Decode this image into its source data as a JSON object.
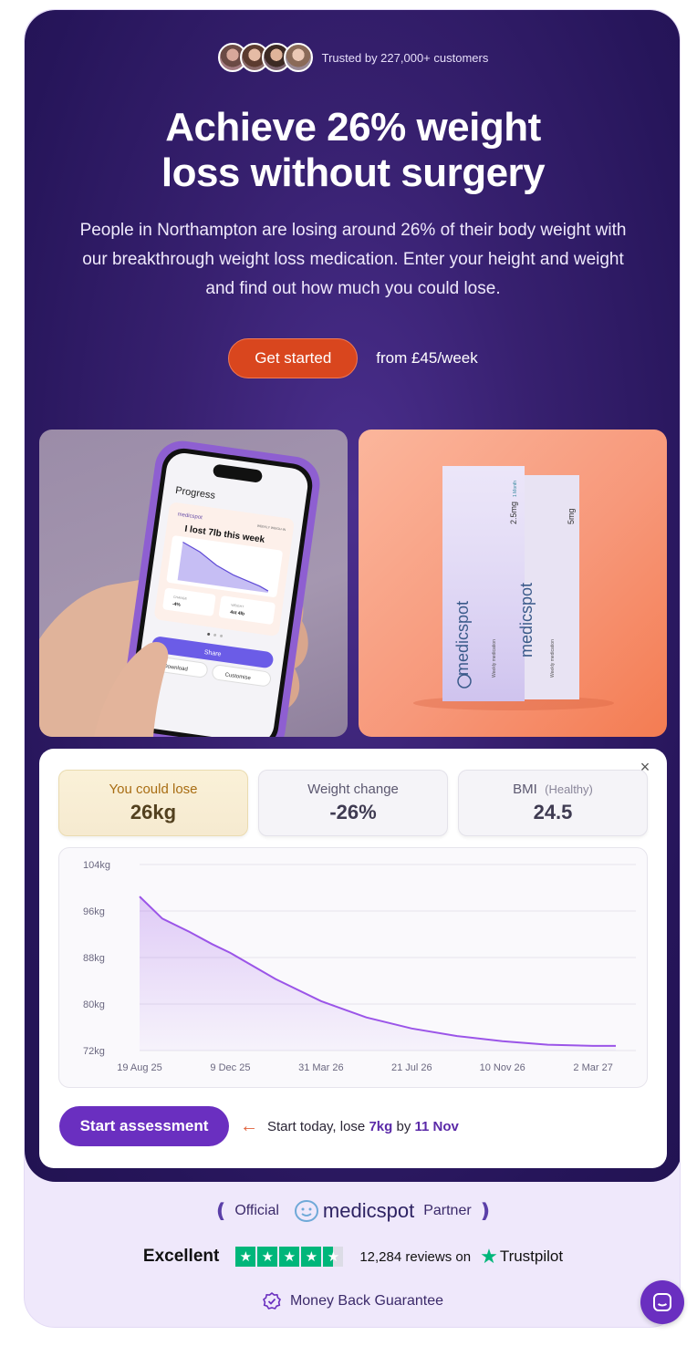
{
  "hero": {
    "trusted_text": "Trusted by 227,000+ customers",
    "headline_line1": "Achieve 26% weight",
    "headline_line2": "loss without surgery",
    "subtitle": "People in Northampton are losing around 26% of their body weight with our breakthrough weight loss medication. Enter your height and weight and find out how much you could lose.",
    "cta_label": "Get started",
    "price_text": "from £45/week"
  },
  "phone_screen": {
    "title": "Progress",
    "brand": "medicspot",
    "tag": "WEEKLY WEIGH-IN",
    "headline": "I lost 7lb this week",
    "change_label": "CHANGE",
    "change_value": "-4%",
    "weight_label": "WEIGHT",
    "weight_value": "4st 4lb",
    "share_label": "Share",
    "download_label": "Download",
    "customise_label": "Customise"
  },
  "product_boxes": {
    "brand": "medicspot",
    "dose_front": "2.5mg",
    "dose_back": "5mg",
    "subtext": "Weekly medication",
    "month_label": "1 Month"
  },
  "calculator": {
    "close_label": "×",
    "stats": {
      "lose_label": "You could lose",
      "lose_value": "26kg",
      "change_label": "Weight change",
      "change_value": "-26%",
      "bmi_label": "BMI",
      "bmi_note": "(Healthy)",
      "bmi_value": "24.5"
    },
    "assess_label": "Start assessment",
    "assess_text_prefix": "Start today, lose ",
    "assess_amount": "7kg",
    "assess_text_mid": " by ",
    "assess_date": "11 Nov"
  },
  "chart_data": {
    "type": "area",
    "y_ticks": [
      "104kg",
      "96kg",
      "88kg",
      "80kg",
      "72kg"
    ],
    "x_ticks": [
      "19 Aug 25",
      "9 Dec 25",
      "31 Mar 26",
      "21 Jul 26",
      "10 Nov 26",
      "2 Mar 27"
    ],
    "ylim": [
      72,
      104
    ],
    "x_index_range": [
      0,
      5.25
    ],
    "x": [
      0,
      0.25,
      0.55,
      0.8,
      1.0,
      1.5,
      2.0,
      2.5,
      3.0,
      3.5,
      4.0,
      4.5,
      5.0,
      5.25
    ],
    "y": [
      98.5,
      94.7,
      92.4,
      90.3,
      88.8,
      84.3,
      80.5,
      77.7,
      75.8,
      74.5,
      73.6,
      73.0,
      72.8,
      72.8
    ],
    "color": "#9b55e8"
  },
  "trust": {
    "official_label": "Official",
    "brand": "medicspot",
    "partner_label": "Partner",
    "excellent_label": "Excellent",
    "rating_stars": 4.5,
    "review_count": "12,284 reviews on",
    "trustpilot_label": "Trustpilot",
    "money_back_label": "Money Back Guarantee"
  },
  "colors": {
    "accent_purple": "#6a2fc0",
    "cta_orange": "#d9461e",
    "trustpilot_green": "#00b67a"
  }
}
